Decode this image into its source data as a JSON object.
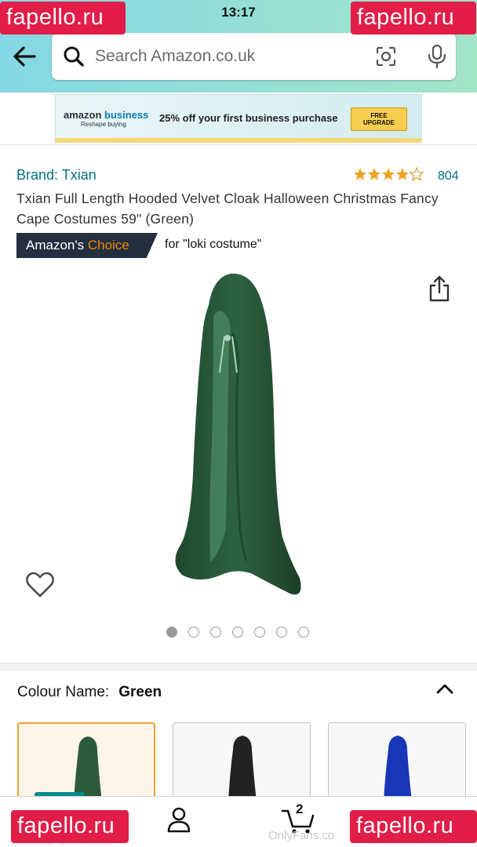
{
  "status_bar": {
    "time": "13:17"
  },
  "search": {
    "placeholder": "Search Amazon.co.uk"
  },
  "banner": {
    "logo_amazon": "amazon",
    "logo_business": "business",
    "logo_tagline": "Reshape buying",
    "offer": "25% off your first business purchase",
    "button_line1": "FREE",
    "button_line2": "UPGRADE"
  },
  "product": {
    "brand": "Brand: Txian",
    "rating": 4.5,
    "rating_count": "804",
    "title": "Txian Full Length Hooded Velvet Cloak Halloween Christmas Fancy Cape Costumes 59\" (Green)",
    "badge_prefix": "Amazon's",
    "badge_accent": "Choice",
    "badge_for": "for \"loki costume\"",
    "image_count": 7,
    "active_image": 0,
    "colour_label": "Colour Name:",
    "colour_value": "Green",
    "swatches": [
      "green",
      "black",
      "blue"
    ]
  },
  "colors": {
    "link": "#007185",
    "badge_bg": "#232f3e",
    "badge_accent": "#f08804",
    "star": "#f0a21c",
    "header_gradient_start": "#84d8e4",
    "header_gradient_end": "#a3e5c9",
    "cloak_green": "#2d5a3a",
    "cloak_black": "#222222",
    "cloak_blue": "#1736b8"
  },
  "nav": {
    "cart_count": "2"
  },
  "overlay": {
    "watermark": "fapello.ru",
    "credit": "OnlyFans.co"
  },
  "icons": [
    "back-arrow-icon",
    "search-icon",
    "camera-icon",
    "mic-icon",
    "star-icon",
    "share-icon",
    "heart-icon",
    "chevron-up-icon",
    "account-icon",
    "cart-icon"
  ]
}
